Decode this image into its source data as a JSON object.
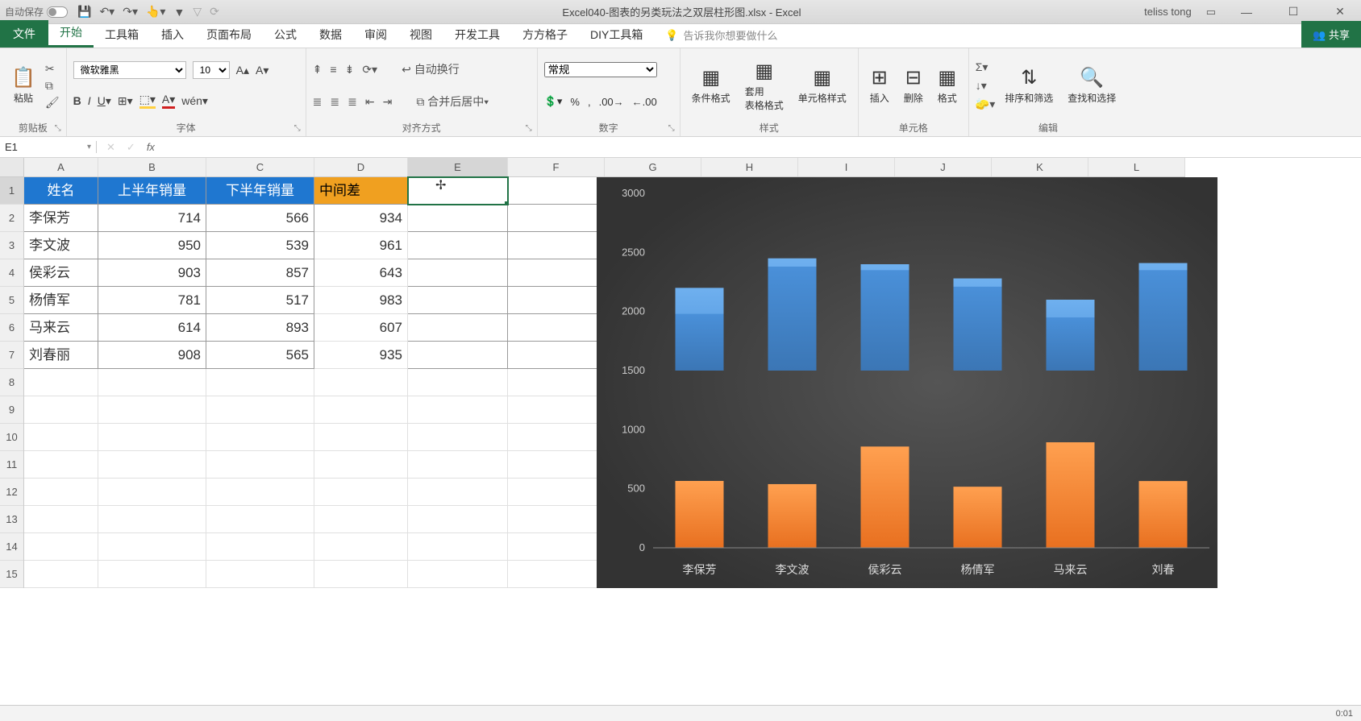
{
  "titlebar": {
    "autosave": "自动保存",
    "filename": "Excel040-图表的另类玩法之双层柱形图.xlsx  -  Excel",
    "username": "teliss tong"
  },
  "tabs": {
    "file": "文件",
    "home": "开始",
    "toolbox": "工具箱",
    "insert": "插入",
    "pagelayout": "页面布局",
    "formulas": "公式",
    "data": "数据",
    "review": "审阅",
    "view": "视图",
    "developer": "开发工具",
    "fanggezi": "方方格子",
    "diy": "DIY工具箱",
    "tellme": "告诉我你想要做什么",
    "share": "共享"
  },
  "ribbon": {
    "clipboard": {
      "paste": "粘贴",
      "label": "剪贴板"
    },
    "font": {
      "name": "微软雅黑",
      "size": "10",
      "label": "字体"
    },
    "align": {
      "wrap": "自动换行",
      "merge": "合并后居中",
      "label": "对齐方式"
    },
    "number": {
      "general": "常规",
      "label": "数字"
    },
    "styles": {
      "cond": "条件格式",
      "table": "套用\n表格格式",
      "cell": "单元格样式",
      "label": "样式"
    },
    "cells": {
      "insert": "插入",
      "delete": "删除",
      "format": "格式",
      "label": "单元格"
    },
    "editing": {
      "sort": "排序和筛选",
      "find": "查找和选择",
      "label": "编辑"
    }
  },
  "namebox": "E1",
  "columns": [
    "A",
    "B",
    "C",
    "D",
    "E",
    "F",
    "G",
    "H",
    "I",
    "J",
    "K",
    "L"
  ],
  "rows_shown": 15,
  "headers": {
    "A": "姓名",
    "B": "上半年销量",
    "C": "下半年销量",
    "D": "中间差"
  },
  "data_rows": [
    {
      "name": "李保芳",
      "h1": 714,
      "h2": 566,
      "diff": 934
    },
    {
      "name": "李文波",
      "h1": 950,
      "h2": 539,
      "diff": 961
    },
    {
      "name": "侯彩云",
      "h1": 903,
      "h2": 857,
      "diff": 643
    },
    {
      "name": "杨倩军",
      "h1": 781,
      "h2": 517,
      "diff": 983
    },
    {
      "name": "马来云",
      "h1": 614,
      "h2": 893,
      "diff": 607
    },
    {
      "name": "刘春丽",
      "h1": 908,
      "h2": 565,
      "diff": 935
    }
  ],
  "active_cell": "E1",
  "chart_data": {
    "type": "bar",
    "ylim": [
      0,
      3000
    ],
    "yticks": [
      0,
      500,
      1000,
      1500,
      2000,
      2500,
      3000
    ],
    "categories": [
      "李保芳",
      "李文波",
      "侯彩云",
      "杨倩军",
      "马来云",
      "刘春"
    ],
    "series": [
      {
        "name": "upper_main",
        "color": "#4a90d9",
        "values": [
          2200,
          2450,
          2400,
          2280,
          2100,
          2410
        ],
        "base": 1500
      },
      {
        "name": "upper_dark",
        "color": "#3b76b5",
        "values": [
          1980,
          2380,
          2350,
          2210,
          1950,
          2350
        ],
        "base": 1500
      },
      {
        "name": "lower",
        "color": "#f08030",
        "values": [
          566,
          539,
          857,
          517,
          893,
          565
        ],
        "base": 0
      }
    ]
  },
  "status_time": "0:01"
}
